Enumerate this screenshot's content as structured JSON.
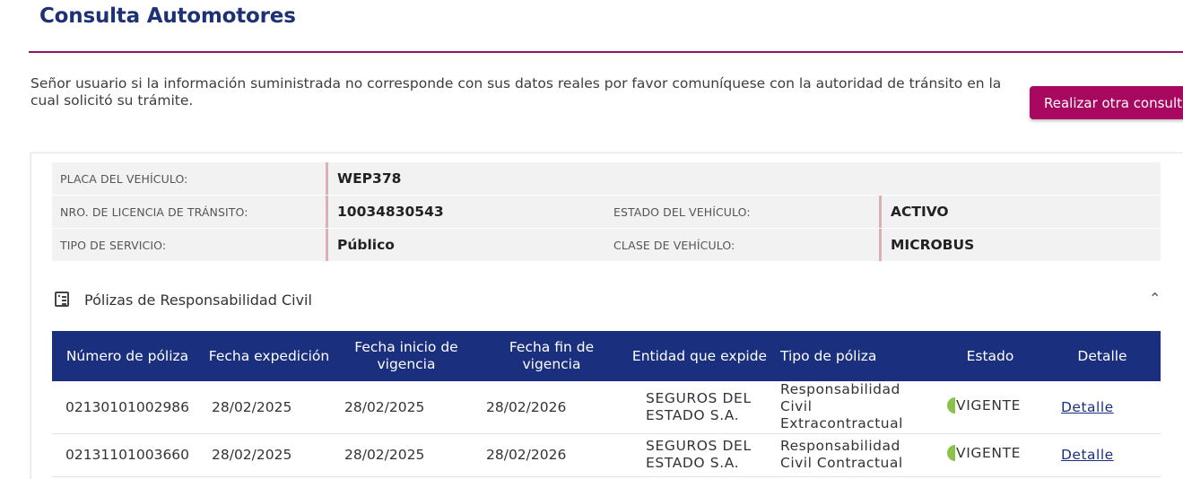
{
  "header": {
    "title": "Consulta Automotores",
    "notice": "Señor usuario si la información suministrada no corresponde con sus datos reales por favor comuníquese con la autoridad de tránsito en la cual solicitó su trámite.",
    "other_button": "Realizar otra consulta"
  },
  "vehicle": {
    "plate_label": "PLACA DEL VEHÍCULO:",
    "plate_value": "WEP378",
    "license_label": "NRO. DE LICENCIA DE TRÁNSITO:",
    "license_value": "10034830543",
    "state_label": "ESTADO DEL VEHÍCULO:",
    "state_value": "ACTIVO",
    "service_label": "TIPO DE SERVICIO:",
    "service_value": "Público",
    "class_label": "CLASE DE VEHÍCULO:",
    "class_value": "MICROBUS"
  },
  "policies": {
    "section_title": "Pólizas de Responsabilidad Civil",
    "section_icon": "list-icon",
    "collapse_icon": "chevron-up-icon",
    "columns": [
      "Número de póliza",
      "Fecha expedición",
      "Fecha inicio de vigencia",
      "Fecha fin de vigencia",
      "Entidad que expide",
      "Tipo de póliza",
      "Estado",
      "Detalle"
    ],
    "rows": [
      {
        "numero": "02130101002986",
        "expedicion": "28/02/2025",
        "inicio": "28/02/2025",
        "fin": "28/02/2026",
        "entidad": "SEGUROS DEL ESTADO S.A.",
        "tipo": "Responsabilidad Civil Extracontractual",
        "estado": "VIGENTE",
        "detalle": "Detalle"
      },
      {
        "numero": "02131101003660",
        "expedicion": "28/02/2025",
        "inicio": "28/02/2025",
        "fin": "28/02/2026",
        "entidad": "SEGUROS DEL ESTADO S.A.",
        "tipo": "Responsabilidad Civil Contractual",
        "estado": "VIGENTE",
        "detalle": "Detalle"
      }
    ]
  },
  "colors": {
    "title": "#1e3175",
    "accent": "#8e1a62",
    "button": "#a8085f",
    "table_header": "#1a2f7e",
    "status_ok": "#8bc34a"
  }
}
